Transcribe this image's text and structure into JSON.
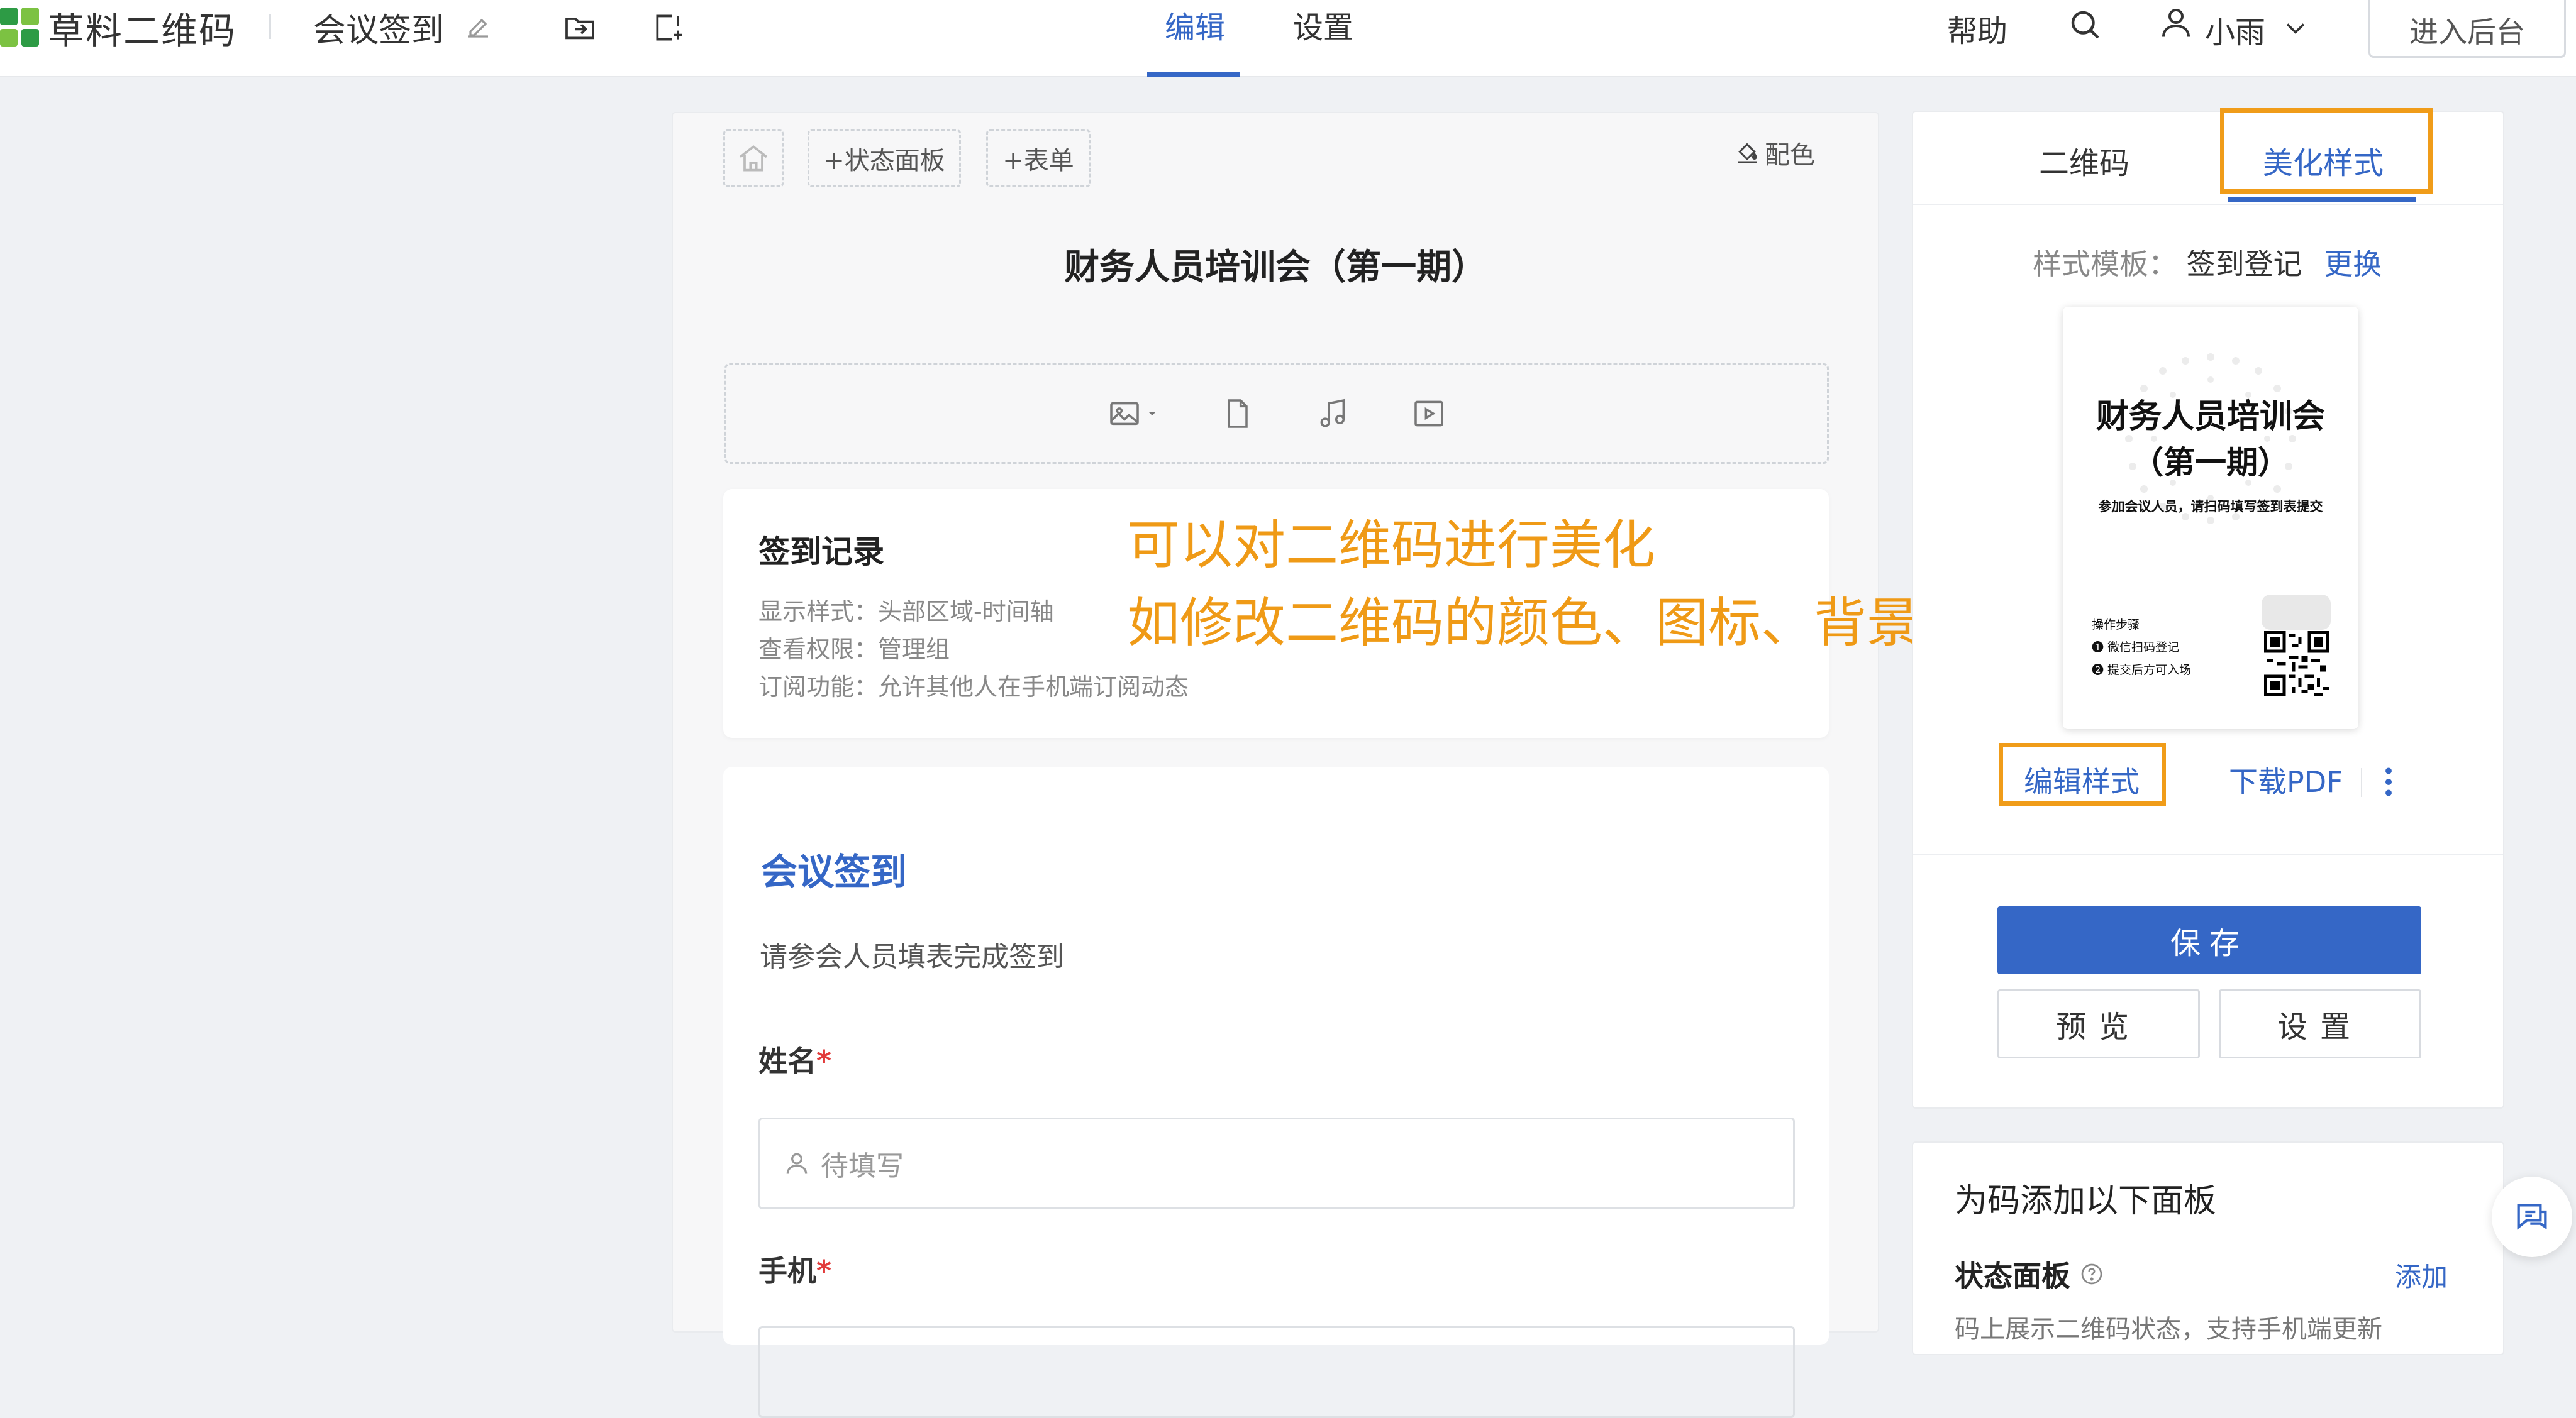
{
  "header": {
    "logo_text": "草料二维码",
    "app_title": "会议签到",
    "tabs": [
      {
        "label": "编辑",
        "active": true
      },
      {
        "label": "设置",
        "active": false
      }
    ],
    "help": "帮助",
    "user_name": "小雨",
    "backend_button": "进入后台",
    "accent_color": "#3567c6"
  },
  "editor": {
    "toolbar": {
      "add_status_panel": "+状态面板",
      "add_form": "+表单",
      "palette": "配色"
    },
    "doc_title": "财务人员培训会（第一期）",
    "media_icons": [
      "image-icon",
      "file-icon",
      "music-icon",
      "video-icon"
    ],
    "record_card": {
      "title": "签到记录",
      "lines": [
        "显示样式：头部区域-时间轴",
        "查看权限：管理组",
        "订阅功能：允许其他人在手机端订阅动态"
      ]
    },
    "annotation": {
      "line1": "可以对二维码进行美化",
      "line2": "如修改二维码的颜色、图标、背景等",
      "color": "#ef9a16"
    },
    "form": {
      "title": "会议签到",
      "description": "请参会人员填表完成签到",
      "fields": [
        {
          "label": "姓名",
          "required_mark": "*",
          "placeholder": "待填写"
        },
        {
          "label": "手机",
          "required_mark": "*",
          "placeholder": ""
        }
      ]
    }
  },
  "right_panel": {
    "tabs": [
      {
        "label": "二维码",
        "active": false
      },
      {
        "label": "美化样式",
        "active": true
      }
    ],
    "template_key": "样式模板：",
    "template_value": "签到登记",
    "template_change": "更换",
    "poster": {
      "title_line1": "财务人员培训会",
      "title_line2": "（第一期）",
      "subtitle": "参加会议人员，请扫码填写签到表提交",
      "steps_title": "操作步骤",
      "steps": [
        "❶ 微信扫码登记",
        "❷ 提交后方可入场"
      ]
    },
    "edit_style": "编辑样式",
    "download_pdf": "下载PDF",
    "save": "保存",
    "preview": "预览",
    "settings": "设置",
    "highlight_color": "#f09c19"
  },
  "panel2": {
    "title": "为码添加以下面板",
    "item_label": "状态面板",
    "item_add": "添加",
    "item_desc": "码上展示二维码状态，支持手机端更新"
  }
}
